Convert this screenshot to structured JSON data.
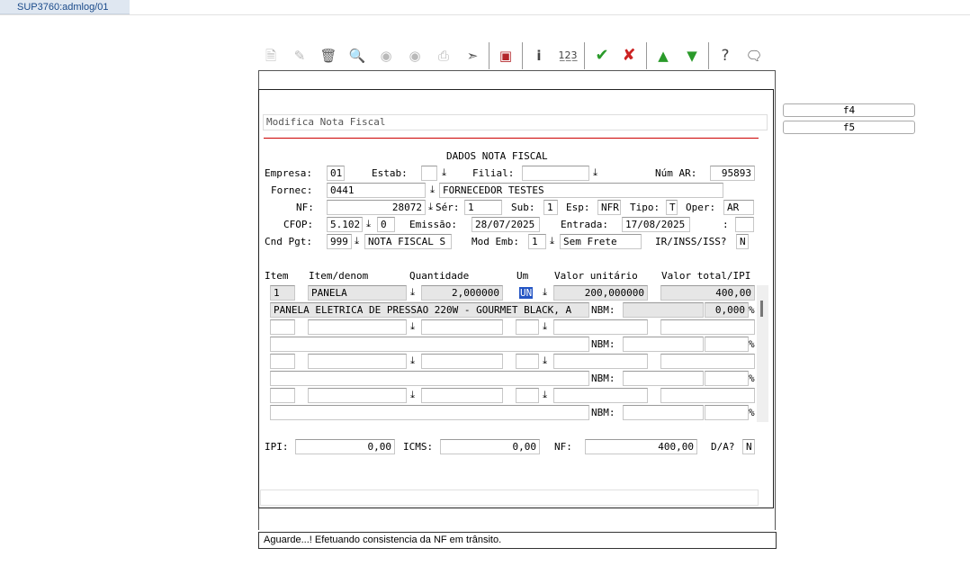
{
  "tab_title": "SUP3760:admlog/01",
  "form_title": "Modifica Nota Fiscal",
  "section_title": "DADOS NOTA FISCAL",
  "fkeys": [
    "f4",
    "f5"
  ],
  "labels": {
    "empresa": "Empresa:",
    "estab": "Estab:",
    "filial": "Filial:",
    "num_ar": "Núm AR:",
    "fornec": "Fornec:",
    "nf": "NF:",
    "ser": "Sér:",
    "sub": "Sub:",
    "esp": "Esp:",
    "tipo": "Tipo:",
    "oper": "Oper:",
    "cfop": "CFOP:",
    "emissao": "Emissão:",
    "entrada": "Entrada:",
    "colon": ":",
    "cnd_pgt": "Cnd Pgt:",
    "mod_emb": "Mod Emb:",
    "ir_inss": "IR/INSS/ISS?",
    "ipi": "IPI:",
    "icms": "ICMS:",
    "nf_total": "NF:",
    "da": "D/A?",
    "nbm": "NBM:",
    "pct": "%"
  },
  "values": {
    "empresa": "01",
    "estab": "",
    "filial": "",
    "num_ar": "95893",
    "fornec_code": "0441",
    "fornec_name": "FORNECEDOR TESTES",
    "nf": "28072",
    "ser": "1",
    "sub": "1",
    "esp": "NFR",
    "tipo": "T",
    "oper": "AR",
    "cfop": "5.102",
    "cfop_seq": "0",
    "emissao": "28/07/2025",
    "entrada": "17/08/2025",
    "extra": "",
    "cnd_pgt_code": "999",
    "cnd_pgt_desc": "NOTA FISCAL S",
    "mod_emb_code": "1",
    "mod_emb_desc": "Sem Frete",
    "ir_inss": "N",
    "ipi": "0,00",
    "icms": "0,00",
    "nf_total": "400,00",
    "da": "N"
  },
  "grid": {
    "headers": [
      "Item",
      "Item/denom",
      "Quantidade",
      "Um",
      "Valor unitário",
      "Valor total/IPI"
    ],
    "rows": [
      {
        "item": "1",
        "denom": "PANELA",
        "qty": "2,000000",
        "um": "UN",
        "unit": "200,000000",
        "total": "400,00",
        "desc": "PANELA ELETRICA DE PRESSAO 220W - GOURMET BLACK, A",
        "nbm": "",
        "pct": "0,000"
      },
      {
        "item": "",
        "denom": "",
        "qty": "",
        "um": "",
        "unit": "",
        "total": "",
        "desc": "",
        "nbm": "",
        "pct": ""
      },
      {
        "item": "",
        "denom": "",
        "qty": "",
        "um": "",
        "unit": "",
        "total": "",
        "desc": "",
        "nbm": "",
        "pct": ""
      },
      {
        "item": "",
        "denom": "",
        "qty": "",
        "um": "",
        "unit": "",
        "total": "",
        "desc": "",
        "nbm": "",
        "pct": ""
      }
    ]
  },
  "status_message": "Aguarde...! Efetuando consistencia da NF em trânsito.",
  "toolbar_icons": [
    "new-icon",
    "edit-icon",
    "delete-icon",
    "search-icon",
    "previous-icon",
    "next-icon",
    "print-icon",
    "export-icon",
    "binoculars-icon",
    "info-icon",
    "sequence-icon",
    "confirm-icon",
    "cancel-icon",
    "up-icon",
    "down-icon",
    "help-icon",
    "chat-icon"
  ]
}
